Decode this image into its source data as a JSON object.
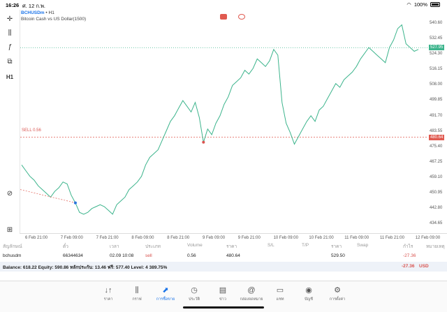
{
  "status": {
    "time": "16:26",
    "date": "ศ. 12 ก.พ.",
    "battery": "100%"
  },
  "toolbar": {
    "timeframe": "H1"
  },
  "chart": {
    "symbol": "BCHUSDm",
    "sep": "•",
    "timeframe": "H1",
    "description": "Bitcoin Cash vs US Dollar(1500)",
    "sell_label": "SELL 0.56",
    "current_price": "527.95",
    "order_price": "480.64",
    "colors": {
      "line": "#3cb48c",
      "bid": "#3cb48c",
      "order": "#e05a50",
      "marker_buy": "#1a73e8",
      "marker_sell": "#d9534f"
    }
  },
  "chart_data": {
    "type": "line",
    "x_labels": [
      "6 Feb 21:00",
      "7 Feb 09:00",
      "7 Feb 21:00",
      "8 Feb 09:00",
      "8 Feb 21:00",
      "9 Feb 09:00",
      "9 Feb 21:00",
      "10 Feb 09:00",
      "10 Feb 21:00",
      "11 Feb 09:00",
      "11 Feb 21:00",
      "12 Feb 09:00"
    ],
    "y_ticks": [
      "540.60",
      "532.45",
      "524.30",
      "516.15",
      "508.00",
      "499.85",
      "491.70",
      "483.55",
      "475.40",
      "467.25",
      "459.10",
      "450.95",
      "442.80",
      "434.65"
    ],
    "ylim": [
      430,
      545
    ],
    "values": [
      466,
      463,
      460,
      458,
      455,
      453,
      451,
      449,
      452,
      454,
      457,
      456,
      450,
      446,
      441,
      440,
      441,
      443,
      444,
      445,
      444,
      442,
      440,
      445,
      447,
      449,
      453,
      455,
      457,
      460,
      466,
      470,
      472,
      474,
      479,
      484,
      489,
      492,
      496,
      500,
      497,
      494,
      499,
      491,
      478,
      485,
      482,
      488,
      492,
      498,
      502,
      508,
      510,
      512,
      516,
      514,
      517,
      522,
      520,
      518,
      521,
      527,
      524,
      499,
      488,
      483,
      477,
      481,
      485,
      489,
      492,
      489,
      495,
      497,
      501,
      505,
      509,
      507,
      511,
      513,
      515,
      518,
      522,
      525,
      528,
      526,
      524,
      522,
      520,
      528,
      532,
      538,
      540,
      530,
      528,
      526,
      527
    ]
  },
  "positions": {
    "headers": [
      "สัญลักษณ์",
      "ตั๋ว",
      "เวลา",
      "ประเภท",
      "Volume",
      "ราคา",
      "S/L",
      "T/P",
      "ราคา",
      "Swap",
      "กำไร",
      "หมายเหตุ"
    ],
    "rows": [
      {
        "symbol": "bchusdm",
        "ticket": "66344634",
        "time": "02.09 10:08",
        "type": "sell",
        "volume": "0.56",
        "price": "480.64",
        "sl": "",
        "tp": "",
        "current": "529.50",
        "swap": "",
        "profit": "-27.36",
        "comment": ""
      }
    ]
  },
  "balance": {
    "text": "Balance: 618.22 Equity: 590.86 หลักประกัน: 13.46 ฟรี: 577.40 Level: 4 389.75%",
    "profit": "-27.36",
    "currency": "USD"
  },
  "nav": [
    {
      "label": "ราคา",
      "icon": "↓↑"
    },
    {
      "label": "กราฟ",
      "icon": "⫼"
    },
    {
      "label": "การซื้อขาย",
      "icon": "⬈"
    },
    {
      "label": "ประวัติ",
      "icon": "◷"
    },
    {
      "label": "ข่าว",
      "icon": "▤"
    },
    {
      "label": "กล่องจดหมาย",
      "icon": "@"
    },
    {
      "label": "แชท",
      "icon": "▭"
    },
    {
      "label": "บัญชี",
      "icon": "◉"
    },
    {
      "label": "การตั้งค่า",
      "icon": "⚙"
    }
  ]
}
